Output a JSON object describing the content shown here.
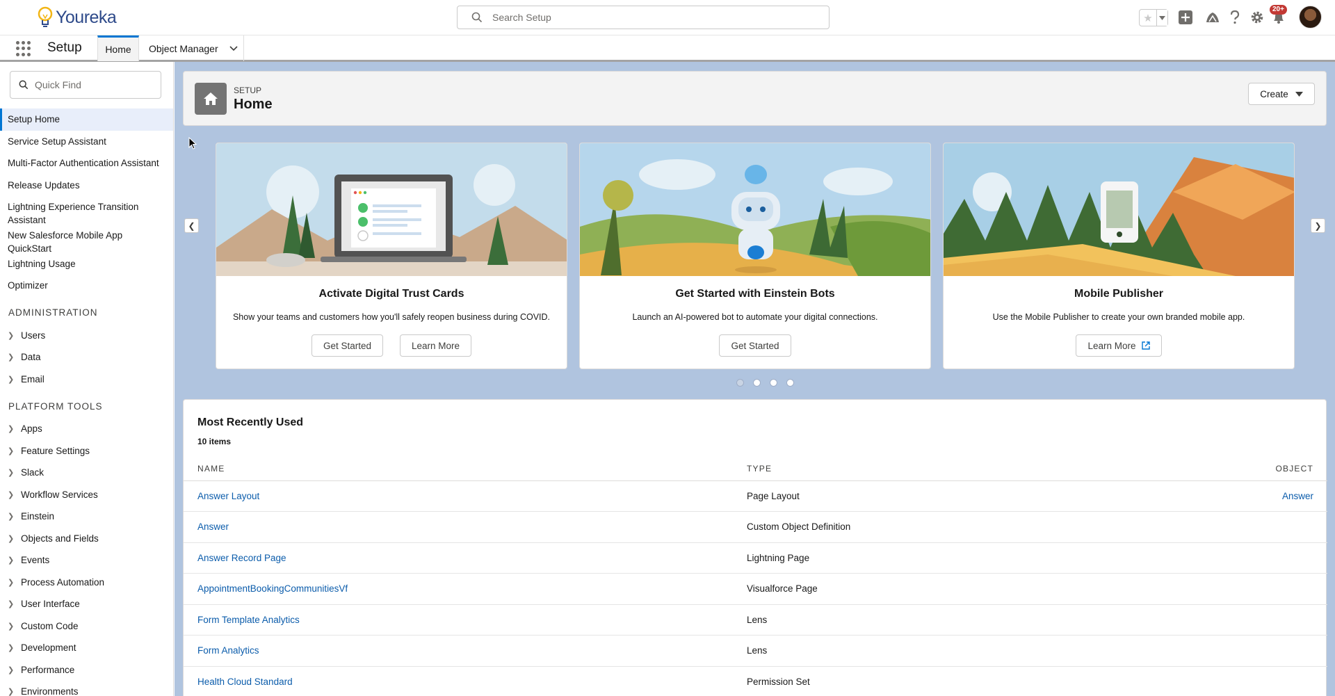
{
  "header": {
    "logo_text": "Youreka",
    "search_placeholder": "Search Setup",
    "notification_badge": "20+"
  },
  "app_nav": {
    "app_name": "Setup",
    "tabs": [
      {
        "label": "Home",
        "active": true
      },
      {
        "label": "Object Manager",
        "has_dropdown": true
      }
    ]
  },
  "sidebar": {
    "quick_find_placeholder": "Quick Find",
    "items": [
      "Setup Home",
      "Service Setup Assistant",
      "Multi-Factor Authentication Assistant",
      "Release Updates",
      "Lightning Experience Transition Assistant",
      "New Salesforce Mobile App QuickStart",
      "Lightning Usage",
      "Optimizer"
    ],
    "sections": [
      {
        "title": "ADMINISTRATION",
        "items": [
          "Users",
          "Data",
          "Email"
        ]
      },
      {
        "title": "PLATFORM TOOLS",
        "items": [
          "Apps",
          "Feature Settings",
          "Slack",
          "Workflow Services",
          "Einstein",
          "Objects and Fields",
          "Events",
          "Process Automation",
          "User Interface",
          "Custom Code",
          "Development",
          "Performance",
          "Environments"
        ]
      }
    ]
  },
  "page_header": {
    "eyebrow": "SETUP",
    "title": "Home",
    "create_label": "Create"
  },
  "carousel": {
    "cards": [
      {
        "title": "Activate Digital Trust Cards",
        "description": "Show your teams and customers how you'll safely reopen business during COVID.",
        "buttons": [
          "Get Started",
          "Learn More"
        ]
      },
      {
        "title": "Get Started with Einstein Bots",
        "description": "Launch an AI-powered bot to automate your digital connections.",
        "buttons": [
          "Get Started"
        ]
      },
      {
        "title": "Mobile Publisher",
        "description": "Use the Mobile Publisher to create your own branded mobile app.",
        "buttons": [
          "Learn More"
        ]
      }
    ],
    "page_count": 4,
    "active_page": 1
  },
  "mru": {
    "title": "Most Recently Used",
    "count": "10 items",
    "columns": [
      "NAME",
      "TYPE",
      "OBJECT"
    ],
    "rows": [
      {
        "name": "Answer Layout",
        "type": "Page Layout",
        "object": "Answer"
      },
      {
        "name": "Answer",
        "type": "Custom Object Definition",
        "object": ""
      },
      {
        "name": "Answer Record Page",
        "type": "Lightning Page",
        "object": ""
      },
      {
        "name": "AppointmentBookingCommunitiesVf",
        "type": "Visualforce Page",
        "object": ""
      },
      {
        "name": "Form Template Analytics",
        "type": "Lens",
        "object": ""
      },
      {
        "name": "Form Analytics",
        "type": "Lens",
        "object": ""
      },
      {
        "name": "Health Cloud Standard",
        "type": "Permission Set",
        "object": ""
      }
    ]
  },
  "colors": {
    "brand_blue": "#0176d3",
    "link": "#0b5cab",
    "main_bg": "#b0c4df",
    "badge_red": "#c23934"
  }
}
